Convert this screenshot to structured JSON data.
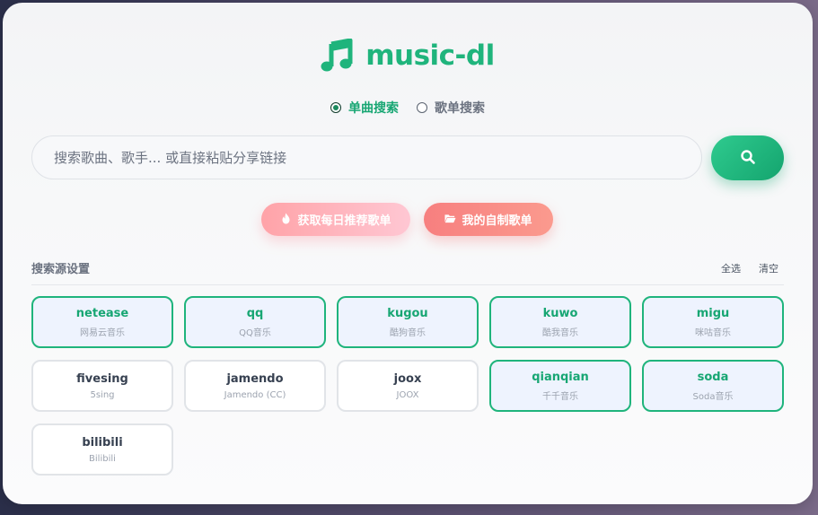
{
  "app": {
    "title": "music-dl",
    "accent_color": "#1fb47c"
  },
  "search_mode": {
    "options": [
      {
        "label": "单曲搜索",
        "checked": true
      },
      {
        "label": "歌单搜索",
        "checked": false
      }
    ]
  },
  "search": {
    "placeholder": "搜索歌曲、歌手... 或直接粘贴分享链接",
    "value": "",
    "button_icon": "search-icon"
  },
  "actions": {
    "daily": {
      "label": "获取每日推荐歌单",
      "icon": "fire-icon"
    },
    "mine": {
      "label": "我的自制歌单",
      "icon": "folder-open-icon"
    }
  },
  "sources_section": {
    "title": "搜索源设置",
    "select_all": "全选",
    "clear": "清空",
    "items": [
      {
        "name": "netease",
        "sub": "网易云音乐",
        "selected": true
      },
      {
        "name": "qq",
        "sub": "QQ音乐",
        "selected": true
      },
      {
        "name": "kugou",
        "sub": "酷狗音乐",
        "selected": true
      },
      {
        "name": "kuwo",
        "sub": "酷我音乐",
        "selected": true
      },
      {
        "name": "migu",
        "sub": "咪咕音乐",
        "selected": true
      },
      {
        "name": "fivesing",
        "sub": "5sing",
        "selected": false
      },
      {
        "name": "jamendo",
        "sub": "Jamendo (CC)",
        "selected": false
      },
      {
        "name": "joox",
        "sub": "JOOX",
        "selected": false
      },
      {
        "name": "qianqian",
        "sub": "千千音乐",
        "selected": true
      },
      {
        "name": "soda",
        "sub": "Soda音乐",
        "selected": true
      },
      {
        "name": "bilibili",
        "sub": "Bilibili",
        "selected": false
      }
    ]
  }
}
